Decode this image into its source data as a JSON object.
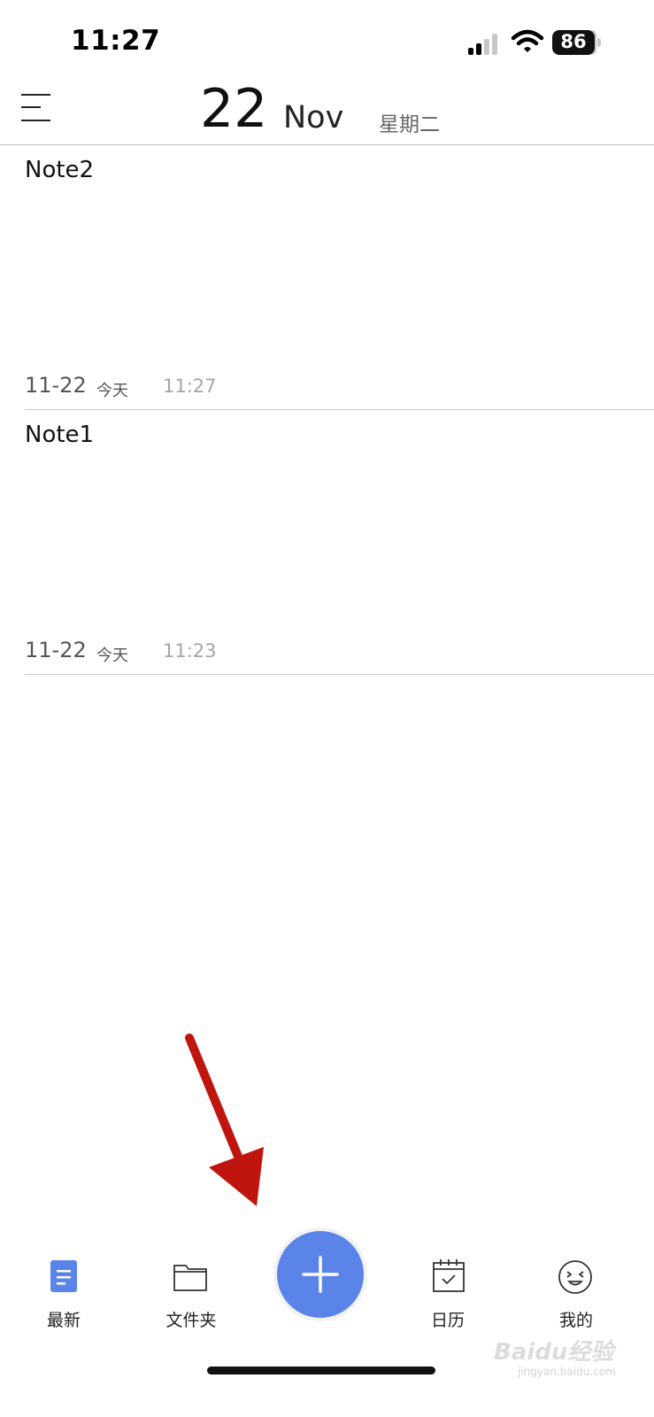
{
  "status_bar": {
    "time": "11:27",
    "battery": "86"
  },
  "header": {
    "day": "22",
    "month": "Nov",
    "weekday": "星期二"
  },
  "notes": [
    {
      "title": "Note2",
      "date": "11-22",
      "day_label": "今天",
      "time": "11:27"
    },
    {
      "title": "Note1",
      "date": "11-22",
      "day_label": "今天",
      "time": "11:23"
    }
  ],
  "tab_bar": {
    "items": [
      {
        "label": "最新",
        "icon": "document-icon",
        "active": true
      },
      {
        "label": "文件夹",
        "icon": "folder-icon"
      },
      {
        "label": "日历",
        "icon": "calendar-check-icon"
      },
      {
        "label": "我的",
        "icon": "smiley-face-icon"
      }
    ],
    "add_icon": "plus-icon"
  },
  "colors": {
    "accent": "#5b84e9",
    "annotation_arrow": "#c0150f"
  },
  "watermark": {
    "brand": "Baidu经验",
    "url": "jingyan.baidu.com"
  }
}
